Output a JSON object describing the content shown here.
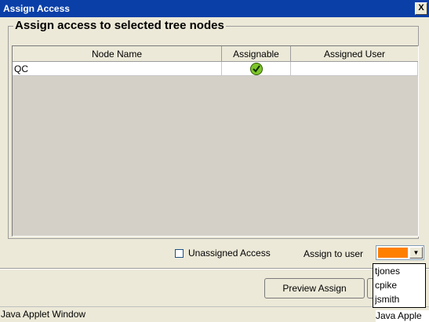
{
  "window": {
    "title": "Assign Access",
    "close_glyph": "X"
  },
  "panel": {
    "title": "Assign access to selected tree nodes"
  },
  "table": {
    "columns": [
      "Node Name",
      "Assignable",
      "Assigned User"
    ],
    "rows": [
      {
        "node_name": "QC",
        "assignable": true,
        "assigned_user": ""
      }
    ]
  },
  "options": {
    "unassigned_label": "Unassigned Access",
    "unassigned_checked": false,
    "assign_to_user_label": "Assign to user",
    "selected_color": "#ff8000"
  },
  "dropdown": {
    "options": [
      "tjones",
      "cpike",
      "jsmith"
    ]
  },
  "buttons": {
    "preview_assign": "Preview Assign"
  },
  "status": {
    "text": "Java Applet Window",
    "overlay_text": "Java Apple"
  },
  "colors": {
    "accent_check": "#5a9e00",
    "title_bar": "#0a3fa8"
  }
}
